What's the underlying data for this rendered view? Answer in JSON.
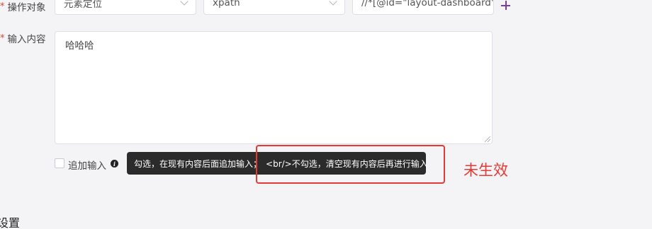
{
  "row1": {
    "label": "操作对象",
    "locator_type": "元素定位",
    "locator_method": "xpath",
    "locator_value": "//*[@id=\"layout-dashboard\"]/s"
  },
  "row2": {
    "label": "输入内容",
    "content": "哈哈哈"
  },
  "append": {
    "label": "追加输入",
    "checked": false,
    "tooltip_part1": "勾选，在现有内容后面追加输入；",
    "tooltip_part2": "<br/>不勾选，清空现有内容后再进行输入"
  },
  "annotation": {
    "text": "未生效",
    "color": "#e53935"
  },
  "section": {
    "title": "设置"
  },
  "icons": {
    "add": "plus-icon",
    "dropdown": "chevron-down-icon",
    "info": "info-icon"
  }
}
